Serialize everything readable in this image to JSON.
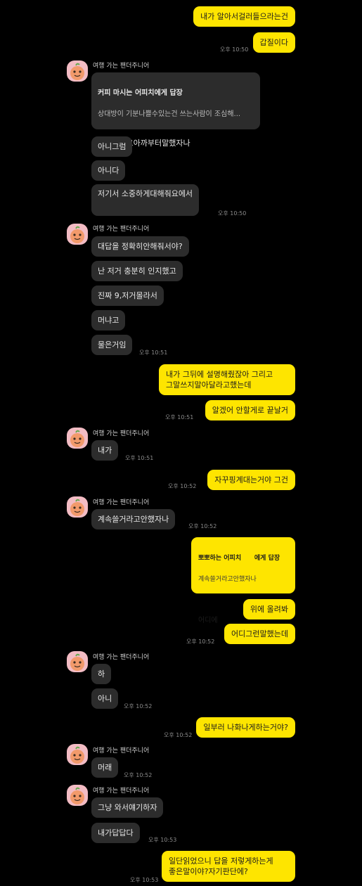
{
  "messages": {
    "m1": {
      "text": "내가 알아서걸러들으라는건"
    },
    "m2": {
      "text": "갑질이다",
      "time": "오후 10:50"
    },
    "s1": {
      "sender": "여행 가는 팬더주니어"
    },
    "m3": {
      "title": "커피 마시는 어피치에게 답장",
      "quote": "상대방이 기분나쁠수있는건 쓰는사람이 조심해...",
      "text": "다급했다고아까부터말했자나"
    },
    "m4": {
      "text": "아니그럼"
    },
    "m5": {
      "text": "아니다"
    },
    "m6": {
      "text": "저기서 소중하게대해줘요에서",
      "time": "오후 10:50"
    },
    "s2": {
      "sender": "여행 가는 팬더주니어"
    },
    "m7": {
      "text": "대답을 정확히안해줘서야?"
    },
    "m8": {
      "text": "난 저거 충분히 인지했고"
    },
    "m9": {
      "text": "진짜 9,저거몰라서"
    },
    "m10": {
      "text": "머냐고"
    },
    "m11": {
      "text": "물은거임",
      "time": "오후 10:51"
    },
    "m12": {
      "text": "내가 그뒤에 설명해줬잖아 그리고\n그말쓰지말아달라고했는데"
    },
    "m13": {
      "text": "알겠어 안할게로 끝날거",
      "time": "오후 10:51"
    },
    "s3": {
      "sender": "여행 가는 팬더주니어"
    },
    "m14": {
      "text": "내가",
      "time": "오후 10:51"
    },
    "m15": {
      "text": "자꾸핑계대는거야 그건",
      "time": "오후 10:52"
    },
    "s4": {
      "sender": "여행 가는 팬더주니어"
    },
    "m16": {
      "text": "계속쓸거라고안했자나",
      "time": "오후 10:52"
    },
    "m17": {
      "title": "뽀뽀하는 어피치      에게 답장",
      "quote": "계속쓸거라고안했자나",
      "text": "어디에"
    },
    "m18": {
      "text": "위에 올려봐"
    },
    "m19": {
      "text": "어디그런말했는데",
      "time": "오후 10:52"
    },
    "s5": {
      "sender": "여행 가는 팬더주니어"
    },
    "m20": {
      "text": "하"
    },
    "m21": {
      "text": "아니",
      "time": "오후 10:52"
    },
    "m22": {
      "text": "일부러 나화나게하는거야?",
      "time": "오후 10:52"
    },
    "s6": {
      "sender": "여행 가는 팬더주니어"
    },
    "m23": {
      "text": "머래",
      "time": "오후 10:52"
    },
    "s7": {
      "sender": "여행 가는 팬더주니어"
    },
    "m24": {
      "text": "그냥 와서얘기하자"
    },
    "m25": {
      "text": "내가답답다",
      "time": "오후 10:53"
    },
    "m26": {
      "text": "일단읽었으니 답을 저렇게하는게\n좋은말이야?자기판단에?",
      "time": "오후 10:53"
    }
  },
  "colors": {
    "outgoing": "#fee500",
    "incoming": "#2c2c2c",
    "background": "#000000",
    "avatar": "#f3bcc4"
  },
  "icons": {
    "avatar": "peach-character-avatar-icon"
  }
}
